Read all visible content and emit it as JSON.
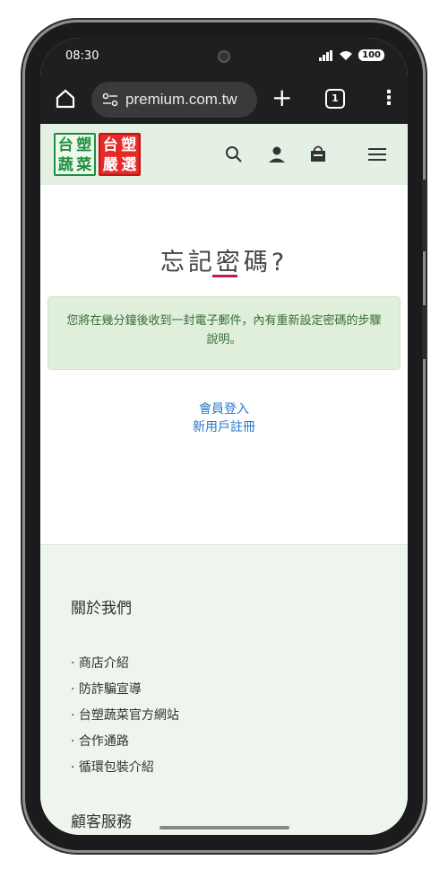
{
  "status_bar": {
    "time": "08:30",
    "battery": "100"
  },
  "browser": {
    "url": "premium.com.tw",
    "tab_count": "1",
    "plus": "+",
    "menu": "⋮"
  },
  "logo": {
    "left_chars": [
      "台",
      "蔬",
      "塑",
      "菜"
    ],
    "right_chars": [
      "台",
      "嚴",
      "塑",
      "選"
    ]
  },
  "page": {
    "title": "忘記密碼?",
    "notice": "您將在幾分鐘後收到一封電子郵件，內有重新設定密碼的步驟說明。",
    "login_link": "會員登入",
    "register_link": "新用戶註冊"
  },
  "footer": {
    "about_heading": "關於我們",
    "about_items": [
      "· 商店介紹",
      "· 防詐騙宣導",
      "· 台塑蔬菜官方網站",
      "· 合作通路",
      "· 循環包裝介紹"
    ],
    "service_heading": "顧客服務"
  },
  "colors": {
    "header_bg": "#e4f0e4",
    "notice_bg": "#e0efdb",
    "link": "#2979c9",
    "accent": "#c2185b"
  }
}
